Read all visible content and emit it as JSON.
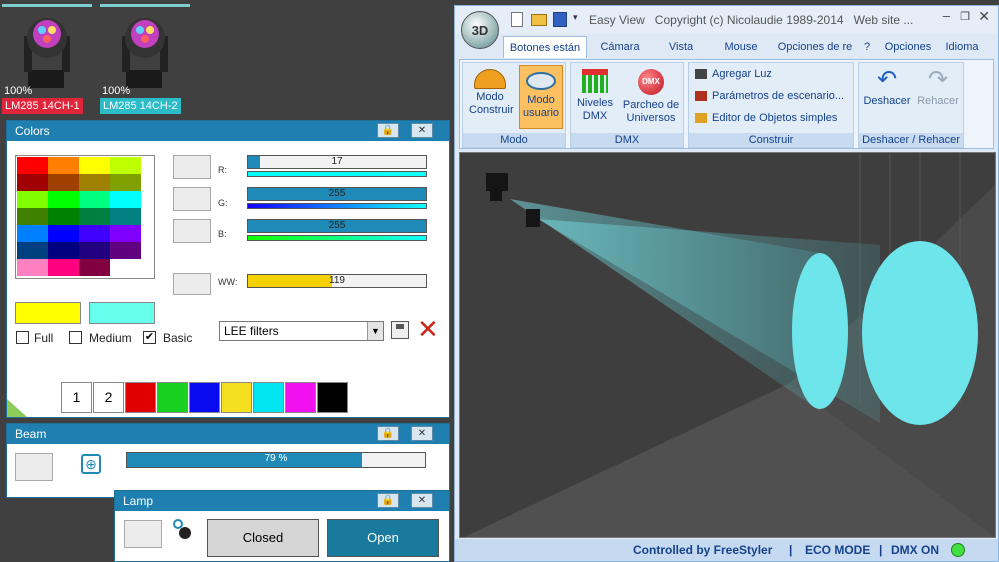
{
  "fixtures": [
    {
      "percent": "100%",
      "label": "LM285 14CH-1",
      "color": "#e0253a"
    },
    {
      "percent": "100%",
      "label": "LM285 14CH-2",
      "color": "#2bbcc8"
    }
  ],
  "colors_panel": {
    "title": "Colors",
    "sliders": {
      "r": {
        "label": "R:",
        "value": "17",
        "fraction": 0.067
      },
      "g": {
        "label": "G:",
        "value": "255",
        "fraction": 1.0
      },
      "b": {
        "label": "B:",
        "value": "255",
        "fraction": 1.0
      },
      "ww": {
        "label": "WW:",
        "value": "119",
        "fraction": 0.47
      }
    },
    "checkboxes": {
      "full": {
        "label": "Full",
        "checked": false
      },
      "medium": {
        "label": "Medium",
        "checked": false
      },
      "basic": {
        "label": "Basic",
        "checked": true
      }
    },
    "filter_select": "LEE filters",
    "preset_numbers": [
      "1",
      "2"
    ],
    "preset_colors": [
      "#e00000",
      "#18d020",
      "#0a0af0",
      "#f5e020",
      "#00e5f0",
      "#f010f0",
      "#000000"
    ],
    "palette": [
      [
        "#ff0000",
        "#ff8000",
        "#ffff00",
        "#c0ff00"
      ],
      [
        "#a00000",
        "#a04000",
        "#a08000",
        "#80a000"
      ],
      [
        "#80ff00",
        "#00ff00",
        "#00ff80",
        "#00ffff"
      ],
      [
        "#408000",
        "#008000",
        "#008040",
        "#008080"
      ],
      [
        "#0080ff",
        "#0000ff",
        "#4000ff",
        "#8000ff"
      ],
      [
        "#004080",
        "#000080",
        "#200080",
        "#600080"
      ],
      [
        "#ff80c0",
        "#ff0080",
        "#800040",
        "#ffffff"
      ]
    ],
    "current_swatch_a": "#ffff00",
    "current_swatch_b": "#66ffee"
  },
  "beam_panel": {
    "title": "Beam",
    "value": "79 %",
    "fraction": 0.79
  },
  "lamp_panel": {
    "title": "Lamp",
    "closed_label": "Closed",
    "open_label": "Open"
  },
  "app_window": {
    "title": "Easy View   Copyright (c) Nicolaudie 1989-2014   Web site ...",
    "logo": "3D",
    "tabs": [
      "Botones están",
      "Cámara",
      "Vista",
      "Mouse",
      "Opciones de re",
      "? ",
      "Opciones",
      "Idioma"
    ],
    "groups": {
      "modo": {
        "name": "Modo",
        "buttons": [
          {
            "line1": "Modo",
            "line2": "Construir"
          },
          {
            "line1": "Modo",
            "line2": "usuario"
          }
        ]
      },
      "dmx": {
        "name": "DMX",
        "buttons": [
          {
            "line1": "Niveles",
            "line2": "DMX"
          },
          {
            "line1": "Parcheo de",
            "line2": "Universos"
          }
        ]
      },
      "construir": {
        "name": "Construir",
        "items": [
          "Agregar Luz",
          "Parámetros de escenario...",
          "Editor de Objetos simples"
        ]
      },
      "undo": {
        "name": "Deshacer / Rehacer",
        "undo": "Deshacer",
        "redo": "Rehacer"
      }
    },
    "status": {
      "controlled": "Controlled by FreeStyler",
      "eco": "ECO MODE",
      "dmx": "DMX ON",
      "sep": "|"
    }
  }
}
